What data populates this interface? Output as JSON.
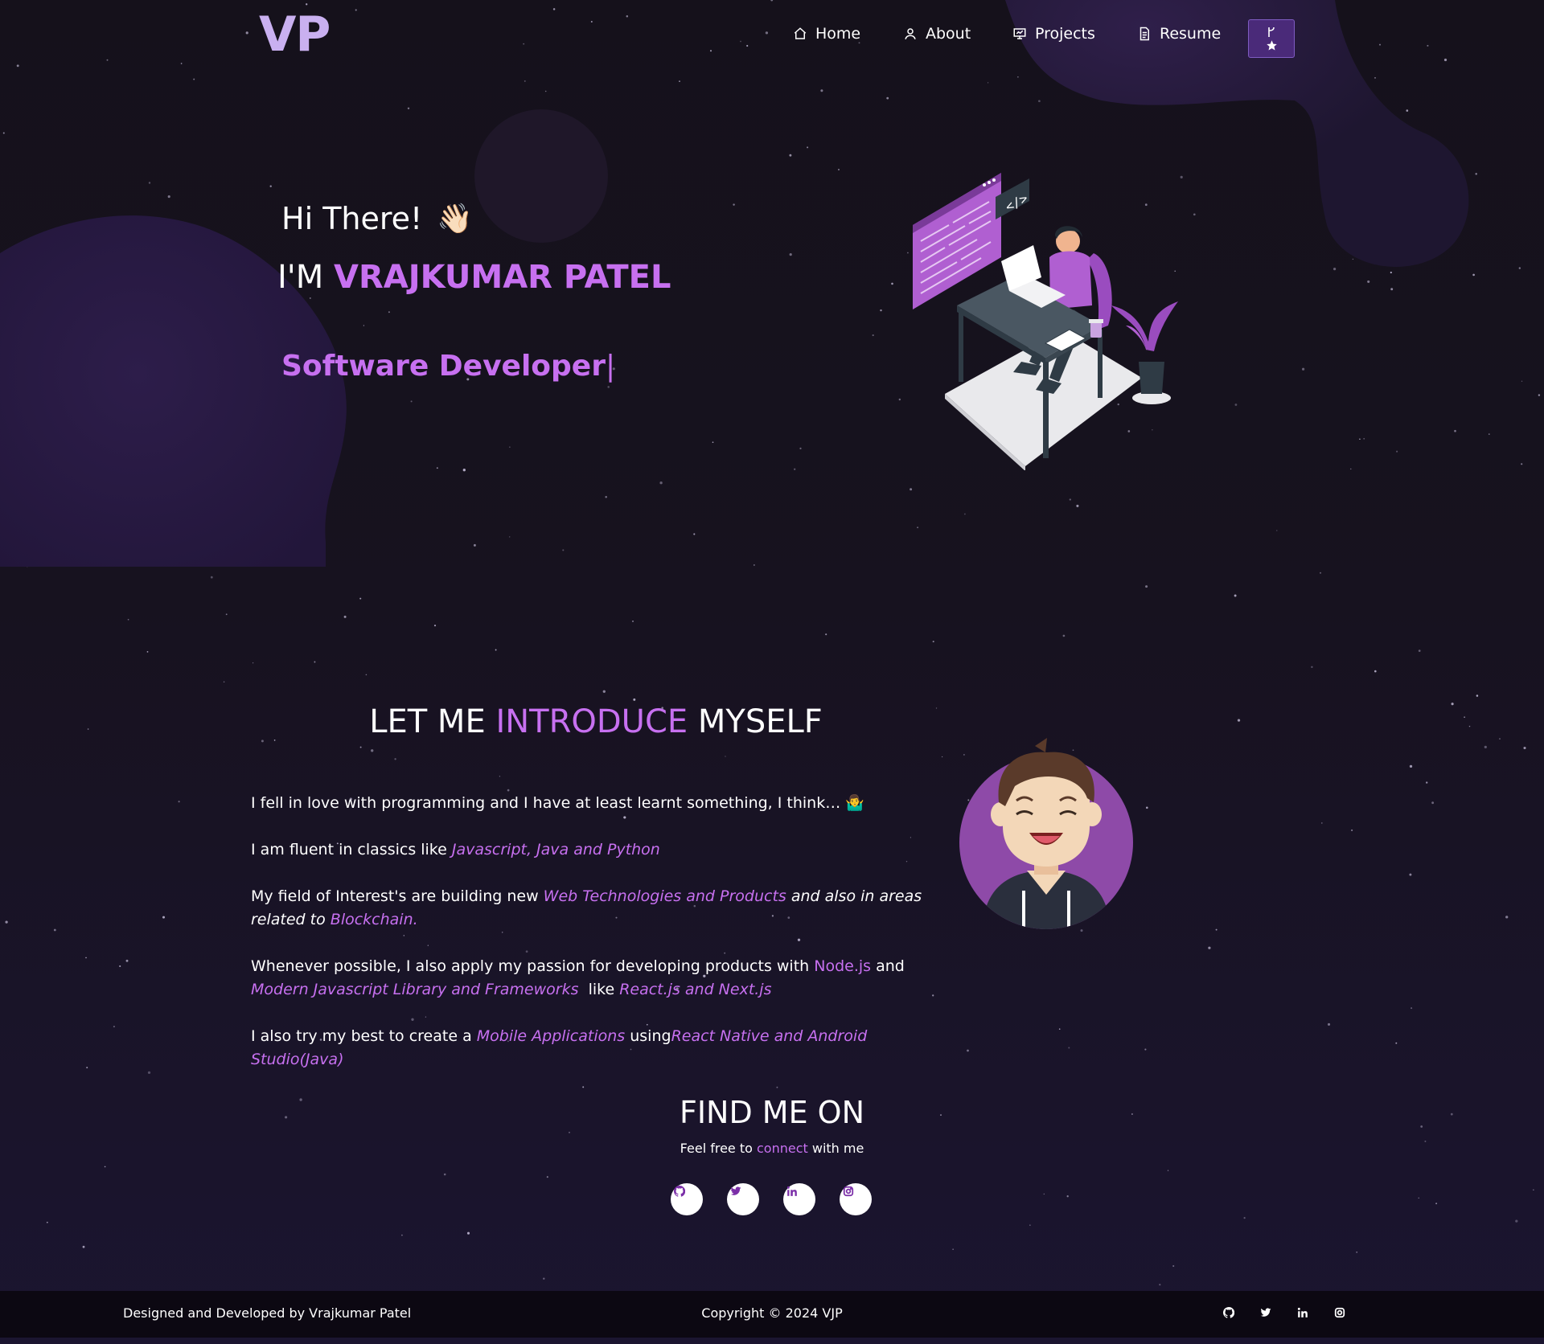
{
  "nav": {
    "logo": "VP",
    "items": [
      {
        "label": "Home",
        "icon": "home-icon"
      },
      {
        "label": "About",
        "icon": "user-icon"
      },
      {
        "label": "Projects",
        "icon": "presentation-icon"
      },
      {
        "label": "Resume",
        "icon": "document-icon"
      }
    ],
    "fork_button_icons": [
      "git-fork-icon",
      "star-icon"
    ]
  },
  "hero": {
    "greeting": "Hi There!",
    "greeting_emoji": "👋🏻",
    "name_prefix": "I'M ",
    "name": "VRAJKUMAR PATEL",
    "role": "Software Developer",
    "cursor": "|"
  },
  "intro": {
    "title_pre": "LET ME ",
    "title_accent": "INTRODUCE",
    "title_post": " MYSELF",
    "p1_text": "I fell in love with programming and I have at least learnt something, I think… ",
    "p1_emoji": "🤷‍♂️",
    "p2_text": "I am fluent in classics like ",
    "p2_em": "Javascript, Java and Python",
    "p3_text": "My field of Interest's are building new ",
    "p3_em1": "Web Technologies and Products",
    "p3_em2": " and also in areas related to ",
    "p3_em3": "Blockchain.",
    "p4_text1": "Whenever possible, I also apply my passion for developing products with ",
    "p4_hl": "Node.js",
    "p4_text2": " and ",
    "p4_em1": "Modern Javascript Library and Frameworks",
    "p4_text3": "  like ",
    "p4_em2": "React.js and Next.js",
    "p5_text1": "I also try my best to create a ",
    "p5_em1": "Mobile Applications",
    "p5_text2": " using",
    "p5_em2": "React Native and Android Studio(Java)"
  },
  "find": {
    "title": "FIND ME ON",
    "sub_pre": "Feel free to ",
    "sub_link": "connect",
    "sub_post": " with me",
    "icons": [
      "github-icon",
      "twitter-icon",
      "linkedin-icon",
      "instagram-icon"
    ]
  },
  "footer": {
    "left": "Designed and Developed by Vrajkumar Patel",
    "center": "Copyright © 2024 VJP"
  },
  "colors": {
    "accent": "#c770f0",
    "background": "#15111b",
    "footer": "#0c0812",
    "button": "#4a2a79"
  }
}
